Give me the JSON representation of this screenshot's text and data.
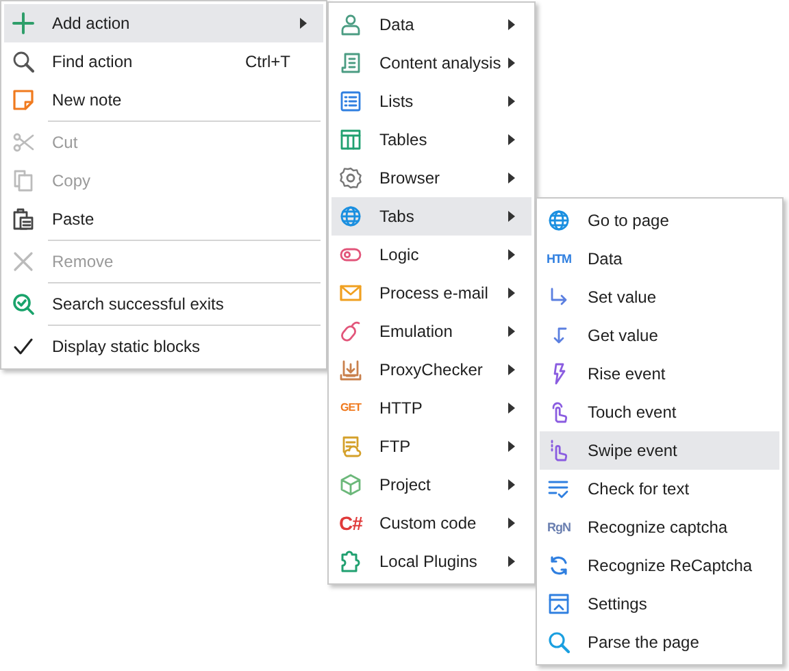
{
  "main_menu": [
    {
      "kind": "item",
      "label": "Add action",
      "submenu": true,
      "selected": true,
      "disabled": false
    },
    {
      "kind": "item",
      "label": "Find action",
      "shortcut": "Ctrl+T",
      "selected": false,
      "disabled": false
    },
    {
      "kind": "item",
      "label": "New note",
      "selected": false,
      "disabled": false
    },
    {
      "kind": "separator"
    },
    {
      "kind": "item",
      "label": "Cut",
      "selected": false,
      "disabled": true
    },
    {
      "kind": "item",
      "label": "Copy",
      "selected": false,
      "disabled": true
    },
    {
      "kind": "item",
      "label": "Paste",
      "selected": false,
      "disabled": false
    },
    {
      "kind": "separator"
    },
    {
      "kind": "item",
      "label": "Remove",
      "selected": false,
      "disabled": true
    },
    {
      "kind": "separator"
    },
    {
      "kind": "item",
      "label": "Search successful exits",
      "selected": false,
      "disabled": false
    },
    {
      "kind": "separator"
    },
    {
      "kind": "item",
      "label": "Display static blocks",
      "checked": true,
      "selected": false,
      "disabled": false
    }
  ],
  "action_menu": [
    {
      "kind": "item",
      "label": "Data",
      "submenu": true,
      "selected": false
    },
    {
      "kind": "item",
      "label": "Content analysis",
      "submenu": true,
      "selected": false
    },
    {
      "kind": "item",
      "label": "Lists",
      "submenu": true,
      "selected": false
    },
    {
      "kind": "item",
      "label": "Tables",
      "submenu": true,
      "selected": false
    },
    {
      "kind": "item",
      "label": "Browser",
      "submenu": true,
      "selected": false
    },
    {
      "kind": "item",
      "label": "Tabs",
      "submenu": true,
      "selected": true
    },
    {
      "kind": "item",
      "label": "Logic",
      "submenu": true,
      "selected": false
    },
    {
      "kind": "item",
      "label": "Process e-mail",
      "submenu": true,
      "selected": false
    },
    {
      "kind": "item",
      "label": "Emulation",
      "submenu": true,
      "selected": false
    },
    {
      "kind": "item",
      "label": "ProxyChecker",
      "submenu": true,
      "selected": false
    },
    {
      "kind": "item",
      "label": "HTTP",
      "icon_label": "GET",
      "submenu": true,
      "selected": false
    },
    {
      "kind": "item",
      "label": "FTP",
      "submenu": true,
      "selected": false
    },
    {
      "kind": "item",
      "label": "Project",
      "submenu": true,
      "selected": false
    },
    {
      "kind": "item",
      "label": "Custom code",
      "icon_label": "C#",
      "submenu": true,
      "selected": false
    },
    {
      "kind": "item",
      "label": "Local Plugins",
      "submenu": true,
      "selected": false
    }
  ],
  "tabs_menu": [
    {
      "kind": "item",
      "label": "Go to page",
      "selected": false
    },
    {
      "kind": "item",
      "label": "Data",
      "icon_label": "HTM",
      "selected": false
    },
    {
      "kind": "item",
      "label": "Set value",
      "selected": false
    },
    {
      "kind": "item",
      "label": "Get value",
      "selected": false
    },
    {
      "kind": "item",
      "label": "Rise event",
      "selected": false
    },
    {
      "kind": "item",
      "label": "Touch event",
      "selected": false
    },
    {
      "kind": "item",
      "label": "Swipe event",
      "selected": true
    },
    {
      "kind": "item",
      "label": "Check for text",
      "selected": false
    },
    {
      "kind": "item",
      "label": "Recognize captcha",
      "icon_label": "RgN",
      "selected": false
    },
    {
      "kind": "item",
      "label": "Recognize ReCaptcha",
      "selected": false
    },
    {
      "kind": "item",
      "label": "Settings",
      "selected": false
    },
    {
      "kind": "item",
      "label": "Parse the page",
      "selected": false
    }
  ]
}
